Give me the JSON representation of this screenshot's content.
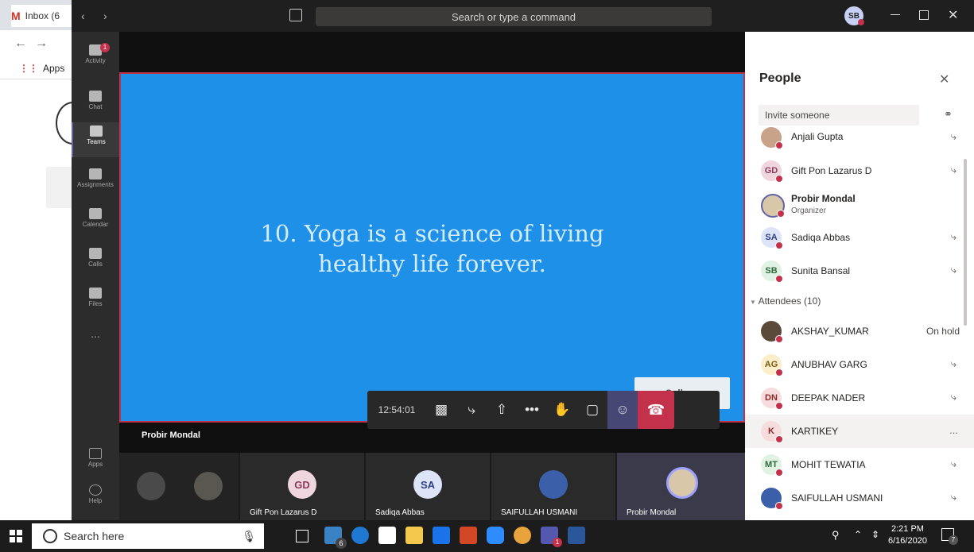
{
  "browser": {
    "tab_label": "Inbox (6",
    "bookmarks_label": "Apps"
  },
  "titlebar": {
    "search_placeholder": "Search or type a command",
    "user_initials": "SB"
  },
  "rail": {
    "items": [
      {
        "label": "Activity",
        "badge": "1"
      },
      {
        "label": "Chat"
      },
      {
        "label": "Teams"
      },
      {
        "label": "Assignments"
      },
      {
        "label": "Calendar"
      },
      {
        "label": "Calls"
      },
      {
        "label": "Files"
      },
      {
        "label": "..."
      },
      {
        "label": "Apps"
      },
      {
        "label": "Help"
      }
    ]
  },
  "slide": {
    "line1": "10. Yoga is a science of living",
    "line2": "healthy life forever.",
    "watermark": "College"
  },
  "controls": {
    "timer": "12:54:01"
  },
  "stage": {
    "speaker_name": "Probir Mondal"
  },
  "thumbnails": [
    {
      "name": "",
      "initials": ""
    },
    {
      "name": "Gift Pon Lazarus D",
      "initials": "GD"
    },
    {
      "name": "Sadiqa Abbas",
      "initials": "SA"
    },
    {
      "name": "SAIFULLAH USMANI",
      "initials": ""
    },
    {
      "name": "Probir Mondal",
      "initials": ""
    }
  ],
  "people": {
    "title": "People",
    "invite_placeholder": "Invite someone",
    "presenters": [
      {
        "name": "Anjali Gupta",
        "initials": "",
        "sub": ""
      },
      {
        "name": "Gift Pon Lazarus D",
        "initials": "GD",
        "sub": ""
      },
      {
        "name": "Probir Mondal",
        "initials": "",
        "sub": "Organizer"
      },
      {
        "name": "Sadiqa Abbas",
        "initials": "SA",
        "sub": ""
      },
      {
        "name": "Sunita Bansal",
        "initials": "SB",
        "sub": ""
      }
    ],
    "attendees_header": "Attendees (10)",
    "attendees": [
      {
        "name": "AKSHAY_KUMAR",
        "initials": "",
        "status": "On hold"
      },
      {
        "name": "ANUBHAV GARG",
        "initials": "AG",
        "status": ""
      },
      {
        "name": "DEEPAK NADER",
        "initials": "DN",
        "status": ""
      },
      {
        "name": "KARTIKEY",
        "initials": "K",
        "status": "..."
      },
      {
        "name": "MOHIT TEWATIA",
        "initials": "MT",
        "status": ""
      },
      {
        "name": "SAIFULLAH USMANI",
        "initials": "",
        "status": ""
      }
    ]
  },
  "taskbar": {
    "search_placeholder": "Search here",
    "mail_badge": "6",
    "teams_badge": "1",
    "notif_badge": "7",
    "time": "2:21 PM",
    "date": "6/16/2020"
  }
}
